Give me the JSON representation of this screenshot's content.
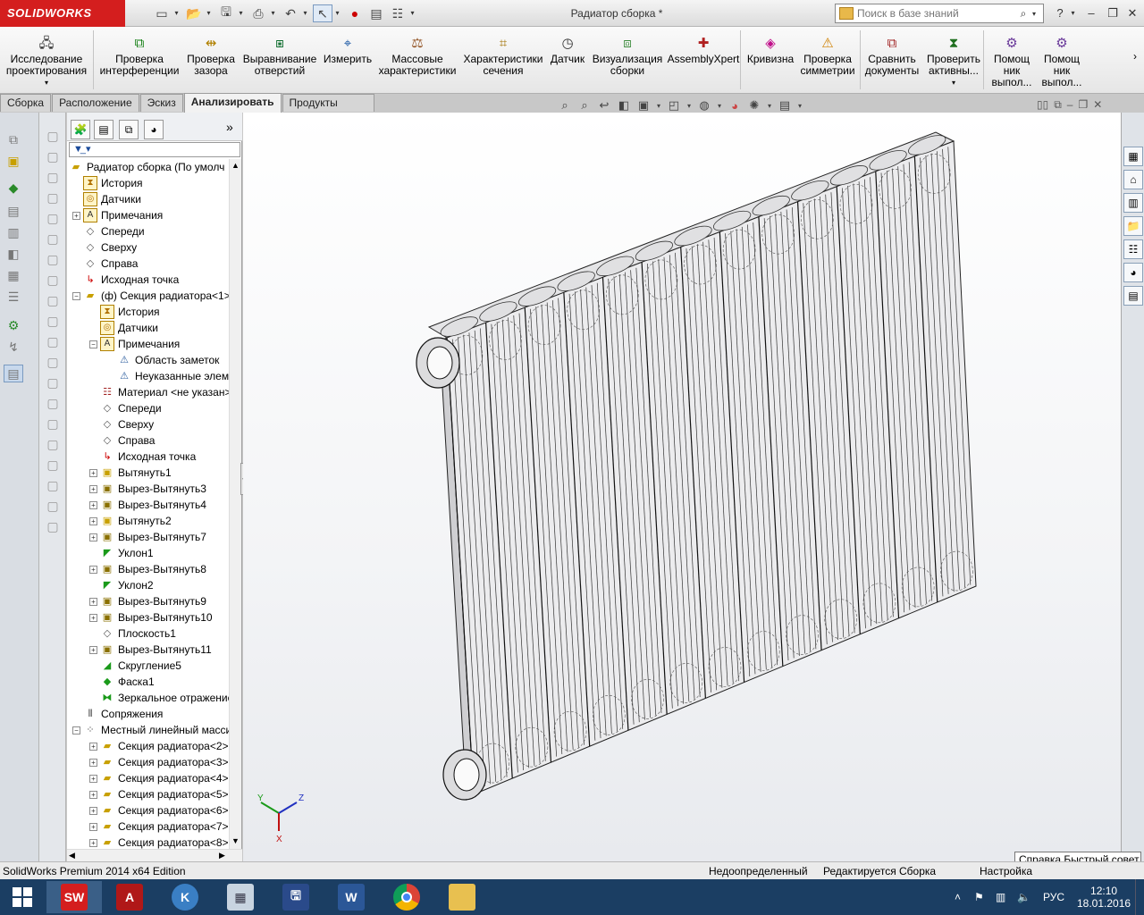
{
  "app": {
    "brand": "SOLIDWORKS",
    "document_title": "Радиатор сборка *",
    "search_placeholder": "Поиск в базе знаний",
    "help_icon": "?"
  },
  "command_manager": {
    "items": [
      {
        "label": "Исследование\nпроектирования",
        "icon": "design-study-icon"
      },
      {
        "label": "Проверка\nинтерференции",
        "icon": "interference-icon"
      },
      {
        "label": "Проверка\nзазора",
        "icon": "clearance-icon"
      },
      {
        "label": "Выравнивание\nотверстий",
        "icon": "hole-alignment-icon"
      },
      {
        "label": "Измерить",
        "icon": "measure-icon"
      },
      {
        "label": "Массовые\nхарактеристики",
        "icon": "mass-properties-icon"
      },
      {
        "label": "Характеристики\nсечения",
        "icon": "section-properties-icon"
      },
      {
        "label": "Датчик",
        "icon": "sensor-icon"
      },
      {
        "label": "Визуализация\nсборки",
        "icon": "assembly-visualization-icon"
      },
      {
        "label": "AssemblyXpert",
        "icon": "assemblyxpert-icon"
      },
      {
        "label": "Кривизна",
        "icon": "curvature-icon"
      },
      {
        "label": "Проверка\nсимметрии",
        "icon": "symmetry-check-icon"
      },
      {
        "label": "Сравнить\nдокументы",
        "icon": "compare-documents-icon"
      },
      {
        "label": "Проверить\nактивны...",
        "icon": "check-active-icon"
      },
      {
        "label": "Помощ\nник\nвыпол...",
        "icon": "wizard-icon"
      },
      {
        "label": "Помощ\nник\nвыпол...",
        "icon": "wizard-icon"
      }
    ]
  },
  "tabs": [
    "Сборка",
    "Расположение",
    "Эскиз",
    "Анализировать",
    "Продукты Office"
  ],
  "active_tab": "Анализировать",
  "tree": {
    "root": "Радиатор сборка  (По умолч",
    "rows": [
      {
        "indent": 0,
        "label": "История",
        "toggle": "",
        "icon": "history-icon"
      },
      {
        "indent": 0,
        "label": "Датчики",
        "toggle": "",
        "icon": "sensors-icon"
      },
      {
        "indent": 0,
        "label": "Примечания",
        "toggle": "+",
        "icon": "annotations-icon"
      },
      {
        "indent": 0,
        "label": "Спереди",
        "toggle": "",
        "icon": "plane-icon"
      },
      {
        "indent": 0,
        "label": "Сверху",
        "toggle": "",
        "icon": "plane-icon"
      },
      {
        "indent": 0,
        "label": "Справа",
        "toggle": "",
        "icon": "plane-icon"
      },
      {
        "indent": 0,
        "label": "Исходная точка",
        "toggle": "",
        "icon": "origin-icon"
      },
      {
        "indent": 0,
        "label": "(ф) Секция радиатора<1>",
        "toggle": "−",
        "icon": "part-icon"
      },
      {
        "indent": 1,
        "label": "История",
        "toggle": "",
        "icon": "history-icon"
      },
      {
        "indent": 1,
        "label": "Датчики",
        "toggle": "",
        "icon": "sensors-icon"
      },
      {
        "indent": 1,
        "label": "Примечания",
        "toggle": "−",
        "icon": "annotations-icon"
      },
      {
        "indent": 2,
        "label": "Область заметок",
        "toggle": "",
        "icon": "notes-area-icon"
      },
      {
        "indent": 2,
        "label": "Неуказанные элементы",
        "toggle": "",
        "icon": "unspecified-icon"
      },
      {
        "indent": 1,
        "label": "Материал <не указан>",
        "toggle": "",
        "icon": "material-icon"
      },
      {
        "indent": 1,
        "label": "Спереди",
        "toggle": "",
        "icon": "plane-icon"
      },
      {
        "indent": 1,
        "label": "Сверху",
        "toggle": "",
        "icon": "plane-icon"
      },
      {
        "indent": 1,
        "label": "Справа",
        "toggle": "",
        "icon": "plane-icon"
      },
      {
        "indent": 1,
        "label": "Исходная точка",
        "toggle": "",
        "icon": "origin-icon"
      },
      {
        "indent": 1,
        "label": "Вытянуть1",
        "toggle": "+",
        "icon": "extrude-icon"
      },
      {
        "indent": 1,
        "label": "Вырез-Вытянуть3",
        "toggle": "+",
        "icon": "cut-extrude-icon"
      },
      {
        "indent": 1,
        "label": "Вырез-Вытянуть4",
        "toggle": "+",
        "icon": "cut-extrude-icon"
      },
      {
        "indent": 1,
        "label": "Вытянуть2",
        "toggle": "+",
        "icon": "extrude-icon"
      },
      {
        "indent": 1,
        "label": "Вырез-Вытянуть7",
        "toggle": "+",
        "icon": "cut-extrude-icon"
      },
      {
        "indent": 1,
        "label": "Уклон1",
        "toggle": "",
        "icon": "draft-icon"
      },
      {
        "indent": 1,
        "label": "Вырез-Вытянуть8",
        "toggle": "+",
        "icon": "cut-extrude-icon"
      },
      {
        "indent": 1,
        "label": "Уклон2",
        "toggle": "",
        "icon": "draft-icon"
      },
      {
        "indent": 1,
        "label": "Вырез-Вытянуть9",
        "toggle": "+",
        "icon": "cut-extrude-icon"
      },
      {
        "indent": 1,
        "label": "Вырез-Вытянуть10",
        "toggle": "+",
        "icon": "cut-extrude-icon"
      },
      {
        "indent": 1,
        "label": "Плоскость1",
        "toggle": "",
        "icon": "plane-icon"
      },
      {
        "indent": 1,
        "label": "Вырез-Вытянуть11",
        "toggle": "+",
        "icon": "cut-extrude-icon"
      },
      {
        "indent": 1,
        "label": "Скругление5",
        "toggle": "",
        "icon": "fillet-icon"
      },
      {
        "indent": 1,
        "label": "Фаска1",
        "toggle": "",
        "icon": "chamfer-icon"
      },
      {
        "indent": 1,
        "label": "Зеркальное отражение",
        "toggle": "",
        "icon": "mirror-icon"
      },
      {
        "indent": 0,
        "label": "Сопряжения",
        "toggle": "",
        "icon": "mates-icon"
      },
      {
        "indent": 0,
        "label": "Местный линейный массив",
        "toggle": "−",
        "icon": "pattern-icon"
      },
      {
        "indent": 1,
        "label": "Секция радиатора<2>",
        "toggle": "+",
        "icon": "part-icon"
      },
      {
        "indent": 1,
        "label": "Секция радиатора<3>",
        "toggle": "+",
        "icon": "part-icon"
      },
      {
        "indent": 1,
        "label": "Секция радиатора<4>",
        "toggle": "+",
        "icon": "part-icon"
      },
      {
        "indent": 1,
        "label": "Секция радиатора<5>",
        "toggle": "+",
        "icon": "part-icon"
      },
      {
        "indent": 1,
        "label": "Секция радиатора<6>",
        "toggle": "+",
        "icon": "part-icon"
      },
      {
        "indent": 1,
        "label": "Секция радиатора<7>",
        "toggle": "+",
        "icon": "part-icon"
      },
      {
        "indent": 1,
        "label": "Секция радиатора<8>",
        "toggle": "+",
        "icon": "part-icon"
      }
    ]
  },
  "model": {
    "section_count": 13,
    "triad_labels": [
      "Y",
      "Z",
      "X"
    ]
  },
  "tooltip": "Справка Быстрый совет",
  "status": {
    "edition": "SolidWorks Premium 2014 x64 Edition",
    "state": "Недоопределенный",
    "editing": "Редактируется Сборка",
    "settings": "Настройка"
  },
  "taskbar": {
    "apps": [
      "SW",
      "A",
      "K",
      "calc",
      "save",
      "W",
      "chrome",
      "folder"
    ],
    "lang": "РУС",
    "time": "12:10",
    "date": "18.01.2016"
  },
  "colors": {
    "brand_red": "#d41e1e",
    "taskbar": "#1b3e63",
    "viewport_bg": "#f3f4f6"
  }
}
